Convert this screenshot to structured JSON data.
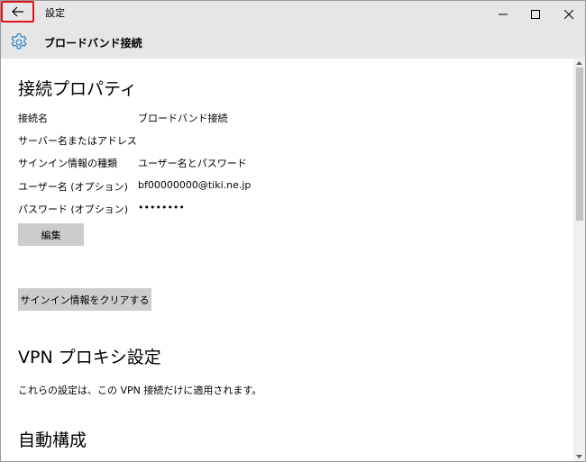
{
  "app": {
    "title": "設定"
  },
  "header": {
    "title": "ブロードバンド接続",
    "icon": "gear-icon"
  },
  "properties": {
    "title": "接続プロパティ",
    "rows": [
      {
        "label": "接続名",
        "value": "ブロードバンド接続"
      },
      {
        "label": "サーバー名またはアドレス",
        "value": ""
      },
      {
        "label": "サインイン情報の種類",
        "value": "ユーザー名とパスワード"
      },
      {
        "label": "ユーザー名 (オプション)",
        "value": "bf00000000@tiki.ne.jp"
      },
      {
        "label": "パスワード (オプション)",
        "value": "••••••••"
      }
    ],
    "edit_label": "編集",
    "clear_label": "サインイン情報をクリアする"
  },
  "vpn": {
    "title": "VPN プロキシ設定",
    "description": "これらの設定は、この VPN 接続だけに適用されます。"
  },
  "auto": {
    "title": "自動構成"
  },
  "colors": {
    "accent": "#2d7dc4",
    "highlight_border": "#e0121d",
    "chrome": "#e6e6e6",
    "button": "#cccccc"
  }
}
